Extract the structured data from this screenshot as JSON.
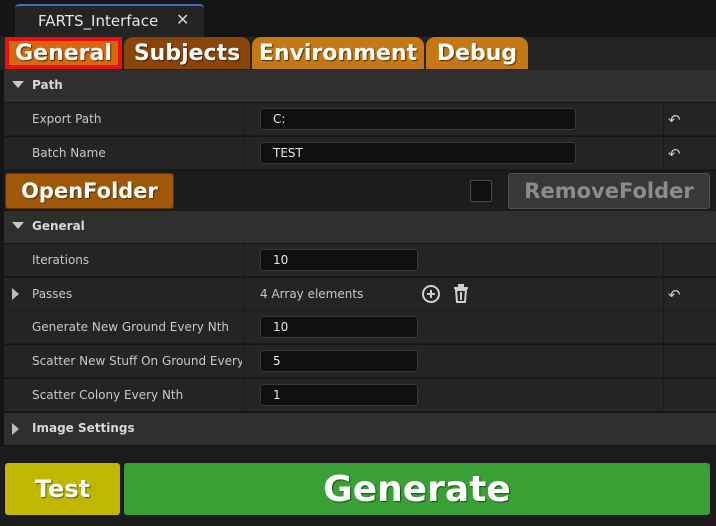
{
  "window": {
    "tab_title": "FARTS_Interface",
    "close_glyph": "✕"
  },
  "category_tabs": [
    {
      "label": "General",
      "selected": true
    },
    {
      "label": "Subjects"
    },
    {
      "label": "Environment"
    },
    {
      "label": "Debug"
    }
  ],
  "path_section": {
    "title": "Path",
    "export_path": {
      "label": "Export Path",
      "value": "C:"
    },
    "batch_name": {
      "label": "Batch Name",
      "value": "TEST"
    }
  },
  "folder_actions": {
    "open_label": "OpenFolder",
    "remove_label": "RemoveFolder",
    "checkbox_checked": false
  },
  "general_section": {
    "title": "General",
    "iterations": {
      "label": "Iterations",
      "value": "10"
    },
    "passes": {
      "label": "Passes",
      "value": "4 Array elements"
    },
    "ground_every": {
      "label": "Generate New Ground Every Nth",
      "value": "10"
    },
    "scatter_every": {
      "label": "Scatter New Stuff On Ground Every…",
      "value": "5"
    },
    "colony_every": {
      "label": "Scatter Colony Every Nth",
      "value": "1"
    }
  },
  "image_settings": {
    "title": "Image Settings"
  },
  "actions": {
    "test_label": "Test",
    "generate_label": "Generate"
  },
  "colors": {
    "accent_tab": "#d8680e",
    "selected_outline": "#ee1010",
    "test": "#c0b800",
    "generate": "#38a034"
  },
  "icons": {
    "reset": "reset-arrow-icon",
    "add": "add-circle-icon",
    "delete": "trash-icon"
  }
}
